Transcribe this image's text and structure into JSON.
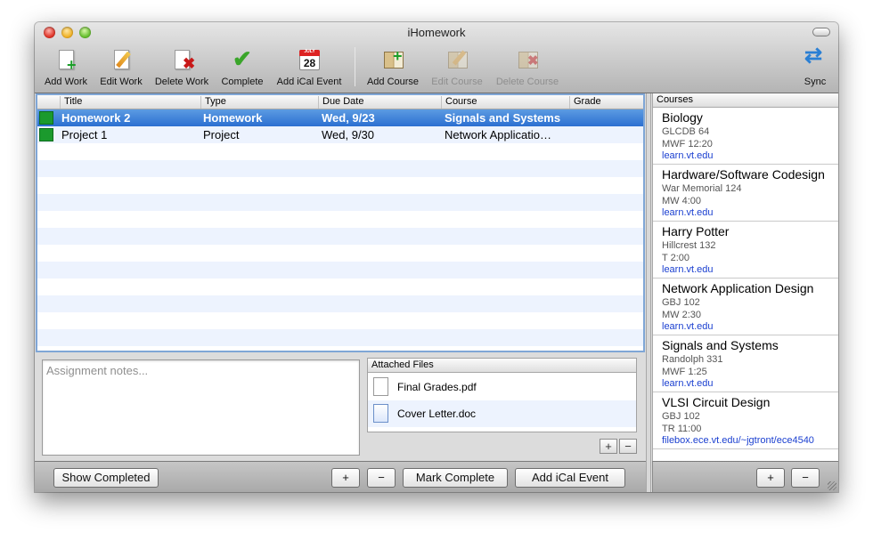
{
  "window": {
    "title": "iHomework"
  },
  "toolbar": {
    "items": [
      {
        "label": "Add Work",
        "icon": "add-work-icon",
        "enabled": true
      },
      {
        "label": "Edit Work",
        "icon": "edit-work-icon",
        "enabled": true
      },
      {
        "label": "Delete Work",
        "icon": "delete-work-icon",
        "enabled": true
      },
      {
        "label": "Complete",
        "icon": "checkmark-icon",
        "enabled": true
      },
      {
        "label": "Add iCal Event",
        "icon": "ical-calendar-icon",
        "calendar_day": "28",
        "calendar_month": "JULY",
        "enabled": true
      },
      {
        "label": "Add Course",
        "icon": "add-course-icon",
        "enabled": true
      },
      {
        "label": "Edit Course",
        "icon": "edit-course-icon",
        "enabled": false
      },
      {
        "label": "Delete Course",
        "icon": "delete-course-icon",
        "enabled": false
      },
      {
        "label": "Sync",
        "icon": "sync-icon",
        "enabled": true
      }
    ]
  },
  "assignments": {
    "columns": [
      "Title",
      "Type",
      "Due Date",
      "Course",
      "Grade"
    ],
    "rows": [
      {
        "title": "Homework 2",
        "type": "Homework",
        "due": "Wed, 9/23",
        "course": "Signals and Systems",
        "grade": "",
        "selected": true,
        "status_color": "#1b9a2d"
      },
      {
        "title": "Project 1",
        "type": "Project",
        "due": "Wed, 9/30",
        "course": "Network Applicatio…",
        "grade": "",
        "selected": false,
        "status_color": "#1b9a2d"
      }
    ]
  },
  "notes": {
    "placeholder": "Assignment notes..."
  },
  "attached_files": {
    "header": "Attached Files",
    "files": [
      {
        "name": "Final Grades.pdf",
        "icon": "pdf-file-icon"
      },
      {
        "name": "Cover Letter.doc",
        "icon": "doc-file-icon"
      }
    ],
    "add_label": "+",
    "remove_label": "−"
  },
  "bottom_bar": {
    "show_completed": "Show Completed",
    "add": "+",
    "remove": "−",
    "mark_complete": "Mark Complete",
    "add_ical_event": "Add iCal Event"
  },
  "courses": {
    "header": "Courses",
    "items": [
      {
        "name": "Biology",
        "location": "GLCDB 64",
        "schedule": "MWF 12:20",
        "link": "learn.vt.edu"
      },
      {
        "name": "Hardware/Software Codesign",
        "location": "War Memorial 124",
        "schedule": "MW 4:00",
        "link": "learn.vt.edu"
      },
      {
        "name": "Harry Potter",
        "location": "Hillcrest 132",
        "schedule": "T 2:00",
        "link": "learn.vt.edu"
      },
      {
        "name": "Network Application Design",
        "location": "GBJ 102",
        "schedule": "MW 2:30",
        "link": "learn.vt.edu"
      },
      {
        "name": "Signals and Systems",
        "location": "Randolph 331",
        "schedule": "MWF 1:25",
        "link": "learn.vt.edu"
      },
      {
        "name": "VLSI Circuit Design",
        "location": "GBJ 102",
        "schedule": "TR 11:00",
        "link": "filebox.ece.vt.edu/~jgtront/ece4540"
      }
    ],
    "add": "+",
    "remove": "−"
  },
  "colors": {
    "selection": "#2b6fd1",
    "status_green": "#1b9a2d",
    "link": "#1a3fd0"
  }
}
